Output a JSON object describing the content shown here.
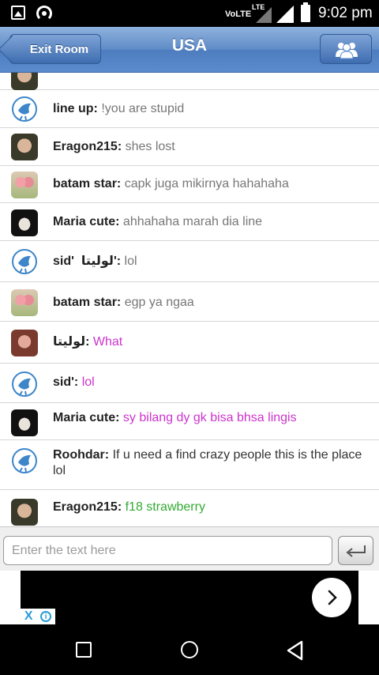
{
  "status_bar": {
    "volte": "VoLTE",
    "lte": "LTE",
    "time": "9:02 pm"
  },
  "header": {
    "exit_label": "Exit Room",
    "title": "USA"
  },
  "messages": [
    {
      "name": "line up:",
      "text": "!you are stupid",
      "color": "gray"
    },
    {
      "name": "Eragon215:",
      "text": "shes lost",
      "color": "gray"
    },
    {
      "name": "batam star:",
      "text": "capk juga mikirnya hahahaha",
      "color": "gray"
    },
    {
      "name": "Maria cute:",
      "text": "ahhahaha marah dia line",
      "color": "gray"
    },
    {
      "name": "sid'  لوليتا':",
      "text": "lol",
      "color": "gray"
    },
    {
      "name": "batam star:",
      "text": "egp ya ngaa",
      "color": "gray"
    },
    {
      "name": "لوليتا:",
      "text": "What",
      "color": "magenta"
    },
    {
      "name": "sid':",
      "text": "lol",
      "color": "magenta"
    },
    {
      "name": "Maria cute:",
      "text": "sy bilang dy gk bisa bhsa lingis",
      "color": "magenta"
    },
    {
      "name": "Roohdar:",
      "text": "If u need a find crazy people this is the place lol",
      "color": "gray"
    },
    {
      "name": "Eragon215:",
      "text": "f18 strawberry",
      "color": "green"
    }
  ],
  "input": {
    "placeholder": "Enter the text here",
    "value": ""
  },
  "ad": {
    "close": "X",
    "info": "i"
  },
  "colors": {
    "nav_blue": "#5b8bcc",
    "magenta": "#cc33cc",
    "green": "#33aa33"
  }
}
